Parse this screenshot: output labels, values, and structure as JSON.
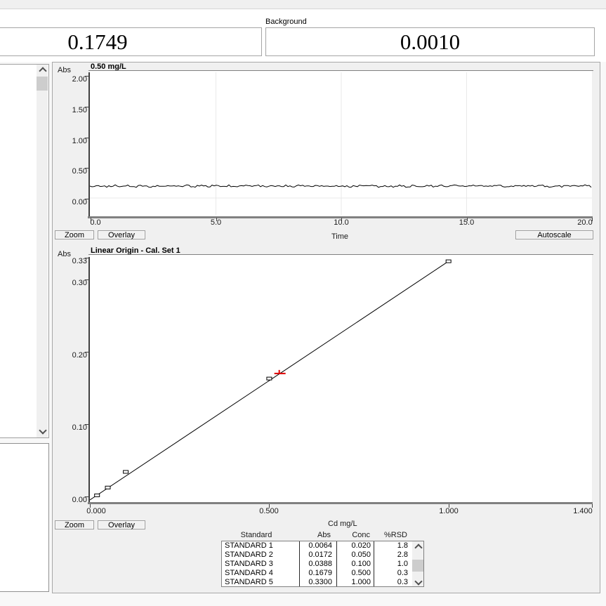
{
  "readout": {
    "signal_value": "0.1749",
    "background_label": "Background",
    "background_value": "0.0010"
  },
  "signal_chart": {
    "ylabel": "Abs",
    "title": "0.50 mg/L",
    "xlabel": "Time",
    "zoom_button": "Zoom",
    "overlay_button": "Overlay",
    "autoscale_button": "Autoscale"
  },
  "cal_chart": {
    "ylabel": "Abs",
    "title": "Linear Origin - Cal. Set 1",
    "xlabel": "Cd mg/L",
    "zoom_button": "Zoom",
    "overlay_button": "Overlay"
  },
  "standards_table": {
    "headers": [
      "Standard",
      "Abs",
      "Conc",
      "%RSD"
    ],
    "rows": [
      {
        "standard": "STANDARD 1",
        "abs": "0.0064",
        "conc": "0.020",
        "rsd": "1.8"
      },
      {
        "standard": "STANDARD 2",
        "abs": "0.0172",
        "conc": "0.050",
        "rsd": "2.8"
      },
      {
        "standard": "STANDARD 3",
        "abs": "0.0388",
        "conc": "0.100",
        "rsd": "1.0"
      },
      {
        "standard": "STANDARD 4",
        "abs": "0.1679",
        "conc": "0.500",
        "rsd": "0.3"
      },
      {
        "standard": "STANDARD 5",
        "abs": "0.3300",
        "conc": "1.000",
        "rsd": "0.3"
      }
    ]
  },
  "colors": {
    "marker_red": "#dd0000",
    "trace_black": "#000000",
    "gridline": "#e9e9e9"
  },
  "chart_data": [
    {
      "id": "signal",
      "type": "line",
      "title": "0.50 mg/L",
      "ylabel": "Abs",
      "xlabel": "Time",
      "xlim": [
        0.0,
        20.0
      ],
      "ylim": [
        -0.25,
        2.1
      ],
      "x_ticks": [
        0.0,
        5.0,
        10.0,
        15.0,
        20.0
      ],
      "x_tick_labels": [
        "0.0",
        "5.0",
        "10.0",
        "15.0",
        "20.0"
      ],
      "y_ticks": [
        2.0,
        1.5,
        1.0,
        0.5,
        0.0
      ],
      "y_tick_labels": [
        "2.00",
        "1.50",
        "1.00",
        "0.50",
        "0.00"
      ],
      "grid": true,
      "series": [
        {
          "name": "absorbance-trace",
          "description": "flat noisy trace",
          "mean_abs": 0.2
        }
      ]
    },
    {
      "id": "calibration",
      "type": "scatter",
      "title": "Linear Origin - Cal. Set 1",
      "ylabel": "Abs",
      "xlabel": "Cd mg/L",
      "xlim": [
        0.0,
        1.4
      ],
      "ylim": [
        0.0,
        0.34
      ],
      "x_ticks": [
        0.0,
        0.5,
        1.0,
        1.4
      ],
      "x_tick_labels": [
        "0.000",
        "0.500",
        "1.000",
        "1.400"
      ],
      "y_ticks": [
        0.33,
        0.3,
        0.2,
        0.1,
        0.0
      ],
      "y_tick_labels": [
        "0.33",
        "0.30",
        "0.20",
        "0.10",
        "0.00"
      ],
      "grid": false,
      "points": [
        {
          "conc": 0.02,
          "abs": 0.0064
        },
        {
          "conc": 0.05,
          "abs": 0.0172
        },
        {
          "conc": 0.1,
          "abs": 0.0388
        },
        {
          "conc": 0.5,
          "abs": 0.1679
        },
        {
          "conc": 1.0,
          "abs": 0.33
        }
      ],
      "fit": {
        "type": "linear-through-origin",
        "slope": 0.33,
        "x_end": 1.0
      },
      "sample_marker": {
        "abs": 0.1749,
        "color": "#dd0000"
      }
    }
  ]
}
